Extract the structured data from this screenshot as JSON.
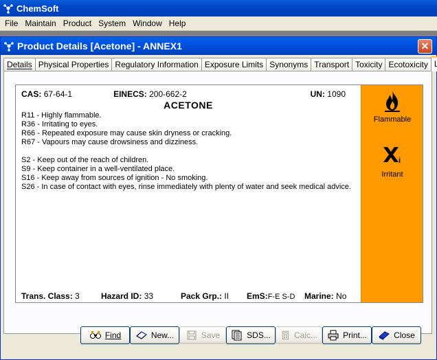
{
  "app": {
    "title": "ChemSoft"
  },
  "menu": [
    "File",
    "Maintain",
    "Product",
    "System",
    "Window",
    "Help"
  ],
  "window": {
    "title": "Product Details [Acetone] - ANNEX1",
    "close_glyph": "✕"
  },
  "tabs": [
    {
      "label": "Details",
      "active": false
    },
    {
      "label": "Physical Properties",
      "active": false
    },
    {
      "label": "Regulatory Information",
      "active": false
    },
    {
      "label": "Exposure Limits",
      "active": false
    },
    {
      "label": "Synonyms",
      "active": false
    },
    {
      "label": "Transport",
      "active": false
    },
    {
      "label": "Toxicity",
      "active": false
    },
    {
      "label": "Ecotoxicity",
      "active": false
    },
    {
      "label": "Label",
      "active": true
    }
  ],
  "label": {
    "cas_label": "CAS:",
    "cas_value": "67-64-1",
    "einecs_label": "EINECS:",
    "einecs_value": "200-662-2",
    "un_label": "UN:",
    "un_value": "1090",
    "product_name": "ACETONE",
    "risk_phrases": [
      "R11 - Highly flammable.",
      "R36 - Irritating to eyes.",
      "R66 - Repeated exposure may cause skin dryness or cracking.",
      "R67 - Vapours may cause drowsiness and dizziness."
    ],
    "safety_phrases": [
      "S2 - Keep out of the reach of children.",
      "S9 - Keep container in a well-ventilated place.",
      "S16 - Keep away from sources of ignition - No smoking.",
      "S26 - In case of contact with eyes, rinse immediately with plenty of water and seek medical advice."
    ],
    "trans_class_label": "Trans. Class:",
    "trans_class_value": "3",
    "hazard_id_label": "Hazard ID:",
    "hazard_id_value": "33",
    "pack_grp_label": "Pack Grp.:",
    "pack_grp_value": "II",
    "ems_label": "EmS:",
    "ems_value": "F-E S-D",
    "marine_label": "Marine:",
    "marine_value": "No"
  },
  "hazards": [
    {
      "label": "Flammable",
      "icon": "flame-icon"
    },
    {
      "label": "Irritant",
      "icon": "cross-icon",
      "sub": "i"
    }
  ],
  "hazard_panel_color": "#ff9900",
  "buttons": [
    {
      "label": "Find",
      "icon": "find-icon",
      "enabled": true
    },
    {
      "label": "New...",
      "icon": "new-icon",
      "enabled": true
    },
    {
      "label": "Save",
      "icon": "save-icon",
      "enabled": false
    },
    {
      "label": "SDS...",
      "icon": "sds-icon",
      "enabled": true
    },
    {
      "label": "Calc...",
      "icon": "calc-icon",
      "enabled": false
    },
    {
      "label": "Print...",
      "icon": "print-icon",
      "enabled": true
    },
    {
      "label": "Close",
      "icon": "close-icon",
      "enabled": true
    }
  ]
}
